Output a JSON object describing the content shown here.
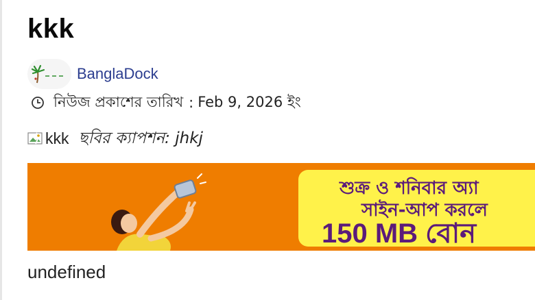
{
  "article": {
    "title": "kkk",
    "author": {
      "name": "BanglaDock",
      "avatar_icon": "palm-tree-logo-icon"
    },
    "published": {
      "icon": "clock-icon",
      "label": "নিউজ প্রকাশের তারিখ",
      "separator": ":",
      "date": "Feb 9, 2026 ইং"
    },
    "image": {
      "alt": "kkk",
      "broken_icon": "broken-image-icon",
      "caption": "ছবির ক্যাপশন: jhkj"
    },
    "ad_banner": {
      "line1": "শুক্র ও শনিবার অ্যা",
      "line2": "সাইন-আপ করলে",
      "line3": "150 MB বোন",
      "colors": {
        "background": "#ef7d00",
        "panel": "#fff24a",
        "text": "#5b1b7a"
      }
    },
    "body": "undefined"
  }
}
